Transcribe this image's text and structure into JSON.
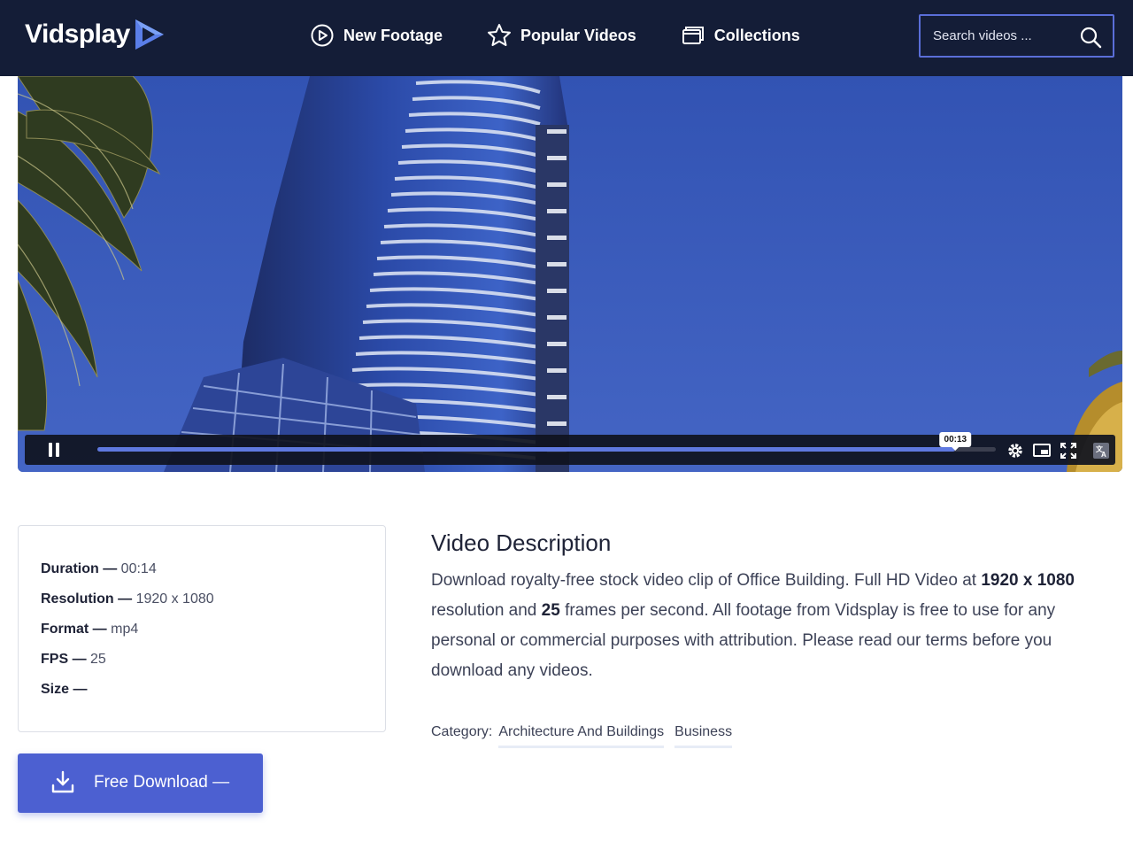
{
  "header": {
    "logo_text": "Vidsplay",
    "nav": [
      {
        "label": "New Footage",
        "icon": "play-circle-icon"
      },
      {
        "label": "Popular Videos",
        "icon": "star-icon"
      },
      {
        "label": "Collections",
        "icon": "collections-icon"
      }
    ],
    "search_placeholder": "Search videos ..."
  },
  "player": {
    "state": "playing",
    "current_time": "00:13",
    "progress_fraction": 0.955,
    "colors": {
      "progress": "#5f79e0",
      "bar": "#0f121e"
    }
  },
  "details": {
    "duration_label": "Duration —",
    "duration": "00:14",
    "resolution_label": "Resolution —",
    "resolution": "1920 x 1080",
    "format_label": "Format —",
    "format": "mp4",
    "fps_label": "FPS —",
    "fps": "25",
    "size_label": "Size —",
    "size": ""
  },
  "download": {
    "label": "Free Download  —"
  },
  "description": {
    "title": "Video Description",
    "text_1": "Download royalty-free stock video clip of Office Building. Full HD Video at ",
    "resolution": "1920 x 1080",
    "text_2": " resolution and ",
    "fps": "25",
    "text_3": " frames per second. All footage from Vidsplay is free to use for any personal or commercial purposes with attribution. Please read our terms before you download any videos."
  },
  "category": {
    "label": "Category:",
    "links": [
      "Architecture And Buildings",
      "Business"
    ]
  },
  "colors": {
    "header_bg": "#141d37",
    "accent": "#4c60d1",
    "sky": "#3a58b5"
  }
}
